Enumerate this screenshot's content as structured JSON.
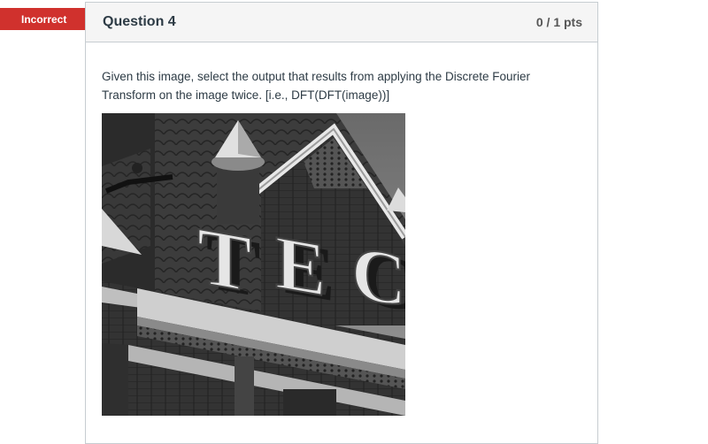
{
  "status": {
    "label": "Incorrect",
    "color": "#d0312d"
  },
  "question": {
    "title": "Question 4",
    "score": "0 / 1 pts",
    "text": "Given this image, select the output that results from applying the Discrete Fourier Transform on the image twice. [i.e., DFT(DFT(image))]"
  },
  "image": {
    "description_icon": "photo-icon"
  }
}
